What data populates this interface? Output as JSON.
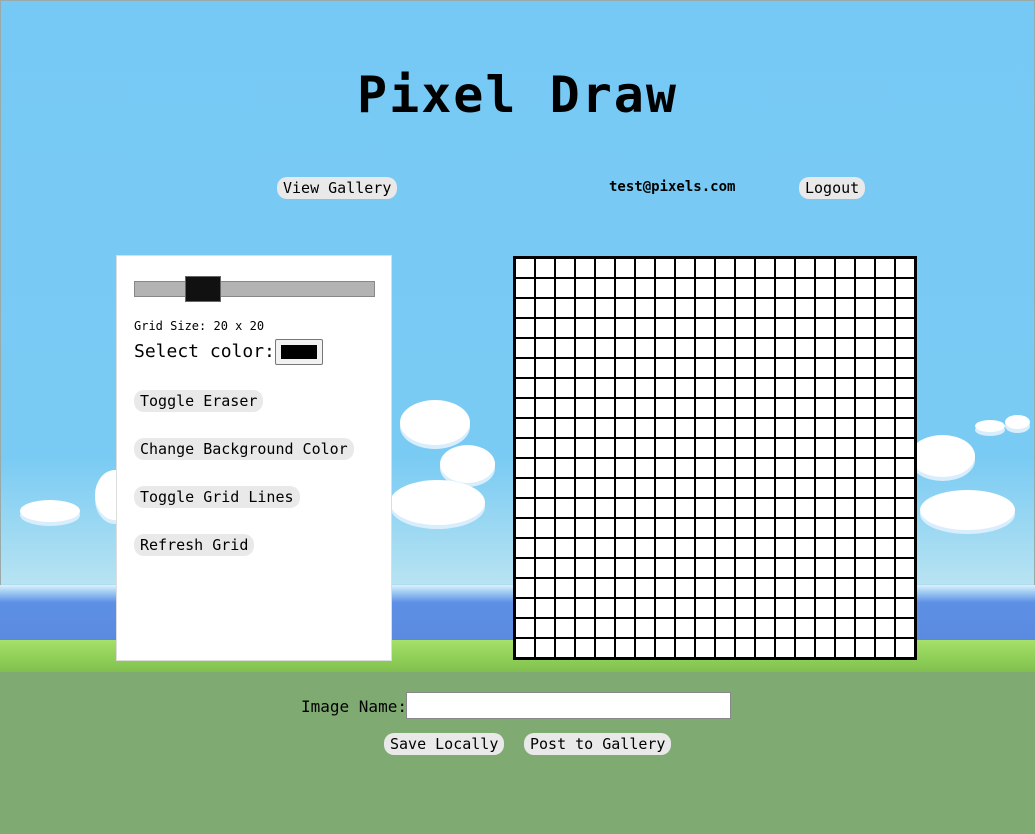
{
  "header": {
    "title": "Pixel Draw"
  },
  "nav": {
    "view_gallery": "View Gallery",
    "user_email": "test@pixels.com",
    "logout": "Logout"
  },
  "controls": {
    "grid_size_label": "Grid Size: 20 x 20",
    "grid_size": 20,
    "slider_fraction": 0.25,
    "select_color_label": "Select color:",
    "selected_color": "#000000",
    "toggle_eraser": "Toggle Eraser",
    "change_background": "Change Background Color",
    "toggle_grid_lines": "Toggle Grid Lines",
    "refresh_grid": "Refresh Grid"
  },
  "save": {
    "image_name_label": "Image Name:",
    "image_name_value": "",
    "save_locally": "Save Locally",
    "post_to_gallery": "Post to Gallery"
  },
  "colors": {
    "sky": "#76c9f5",
    "ground": "#7fab72",
    "button_bg": "#e9e9e9"
  }
}
